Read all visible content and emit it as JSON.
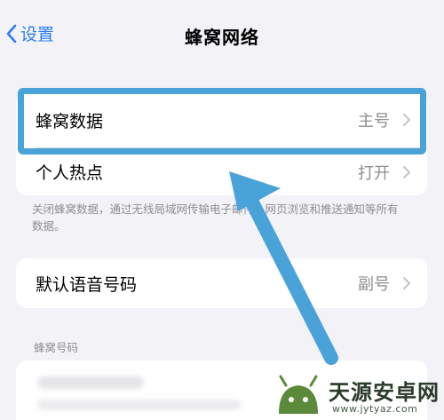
{
  "nav": {
    "back_label": "设置",
    "title": "蜂窝网络"
  },
  "group1": {
    "rows": [
      {
        "label": "蜂窝数据",
        "value": "主号"
      },
      {
        "label": "个人热点",
        "value": "打开"
      }
    ],
    "footer": "关闭蜂窝数据，通过无线局域网传输电子邮件、网页浏览和推送通知等所有数据。"
  },
  "group2": {
    "rows": [
      {
        "label": "默认语音号码",
        "value": "副号"
      }
    ]
  },
  "section3": {
    "header": "蜂窝号码"
  },
  "watermark": {
    "name": "天源安卓网",
    "url": "www.jytyaz.com"
  },
  "colors": {
    "accent": "#2f7cf6",
    "highlight": "#4aa3d8",
    "background": "#f2f2f7"
  }
}
